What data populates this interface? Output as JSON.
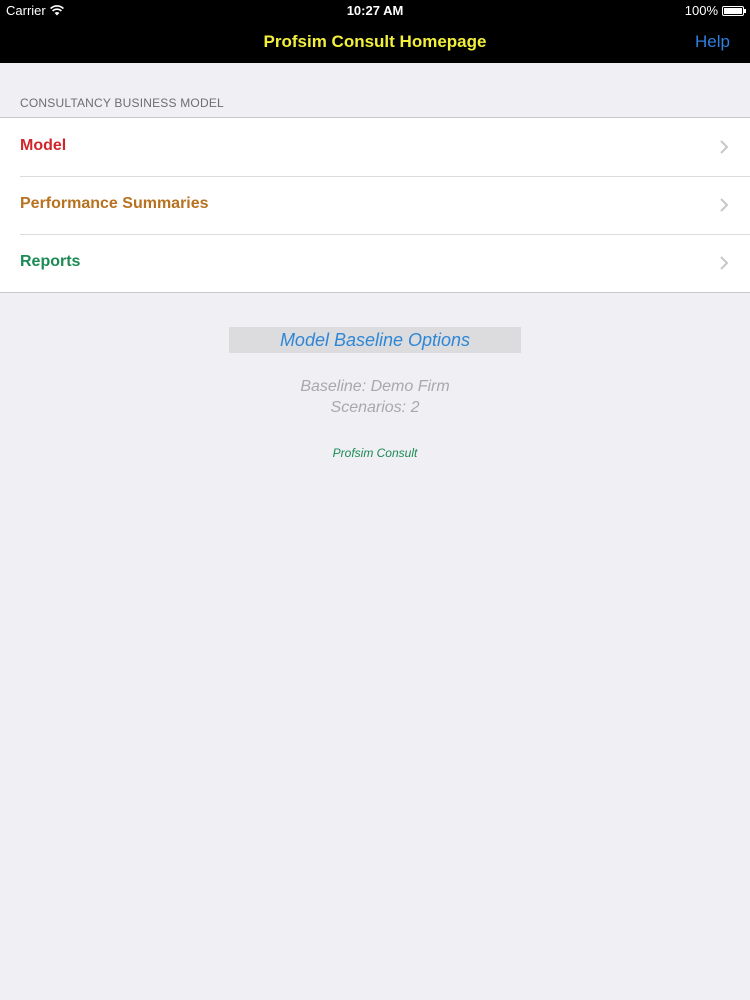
{
  "status_bar": {
    "carrier": "Carrier",
    "wifi_icon": "wifi-icon",
    "time": "10:27 AM",
    "battery_percent": "100%",
    "battery_icon": "battery-icon"
  },
  "nav_bar": {
    "title": "Profsim Consult Homepage",
    "title_color": "#f2f03c",
    "help_label": "Help",
    "help_color": "#2f7fe0",
    "background": "#000000"
  },
  "section": {
    "header": "CONSULTANCY BUSINESS MODEL",
    "items": [
      {
        "label": "Model",
        "color": "#d0262c",
        "icon": "chevron-right-icon"
      },
      {
        "label": "Performance Summaries",
        "color": "#b8711f",
        "icon": "chevron-right-icon"
      },
      {
        "label": "Reports",
        "color": "#1c8a54",
        "icon": "chevron-right-icon"
      }
    ]
  },
  "baseline": {
    "button_label": "Model Baseline Options",
    "button_color": "#2e86d6",
    "baseline_text": "Baseline: Demo Firm",
    "scenarios_text": "Scenarios: 2"
  },
  "footer": {
    "brand": "Profsim Consult",
    "brand_color": "#1c8a54"
  }
}
